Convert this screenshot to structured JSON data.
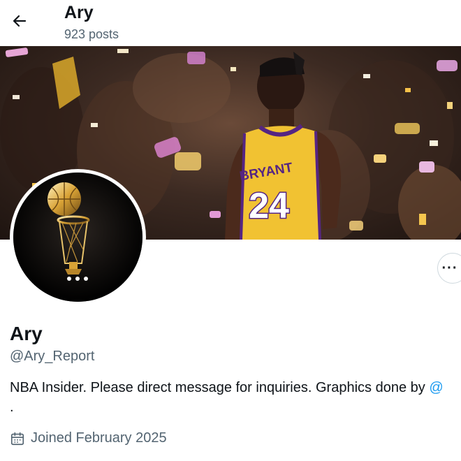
{
  "header": {
    "name": "Ary",
    "posts": "923 posts",
    "back_icon": "arrow-left-icon"
  },
  "banner": {
    "jersey_name": "BRYANT",
    "jersey_number": "24"
  },
  "profile": {
    "display_name": "Ary",
    "handle": "@Ary_Report",
    "bio": "NBA Insider. Please direct message for inquiries. Graphics done by",
    "bio_mention": "@",
    "bio_extra": ".",
    "joined": "Joined February 2025",
    "more_label": "···"
  },
  "colors": {
    "accent": "#1d9bf0",
    "secondary_text": "#536471",
    "jersey_gold": "#f1c232",
    "jersey_purple": "#552583"
  }
}
